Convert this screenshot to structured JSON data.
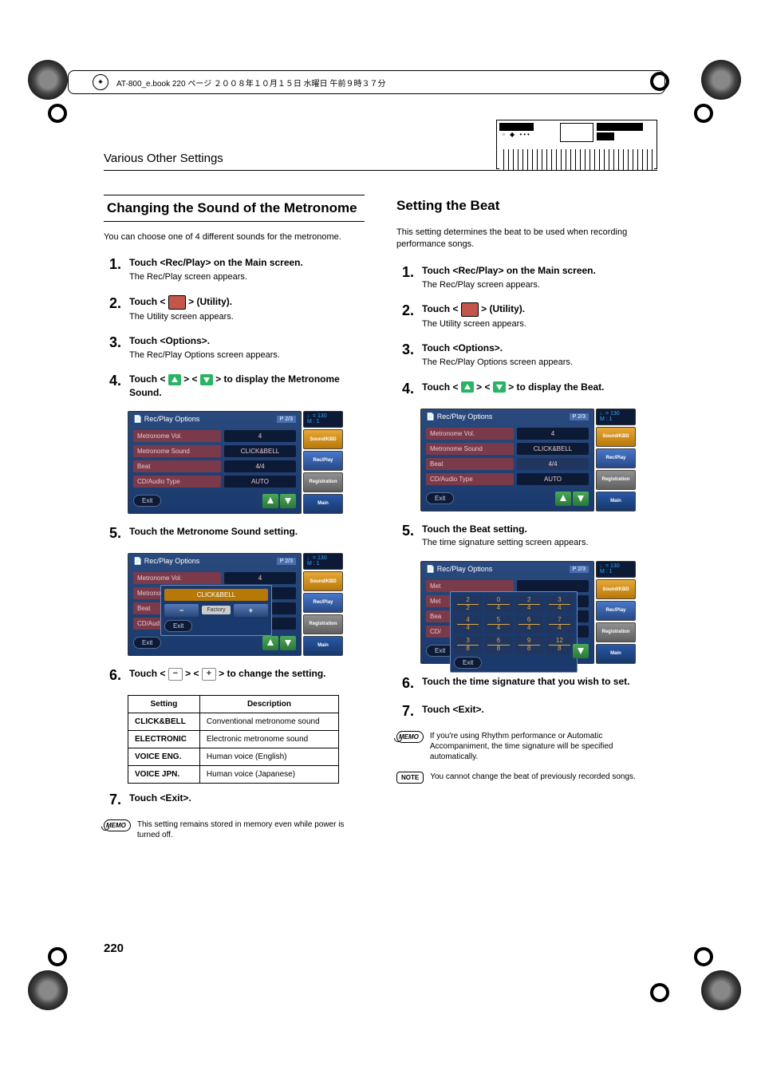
{
  "header_text": "AT-800_e.book  220 ページ  ２００８年１０月１５日  水曜日  午前９時３７分",
  "chapter": "Various Other Settings",
  "page_number": "220",
  "left": {
    "section_title": "Changing the Sound of the Metronome",
    "intro": "You can choose one of 4 different sounds for the metronome.",
    "steps": {
      "s1": {
        "title": "Touch <Rec/Play> on the Main screen.",
        "desc": "The Rec/Play screen appears."
      },
      "s2": {
        "pre": "Touch < ",
        "post": " > (Utility).",
        "desc": "The Utility screen appears."
      },
      "s3": {
        "title": "Touch <Options>.",
        "desc": "The Rec/Play Options screen appears."
      },
      "s4": {
        "pre": "Touch < ",
        "mid": " > < ",
        "post": " > to display the Metronome Sound."
      },
      "s5": {
        "title": "Touch the Metronome Sound setting."
      },
      "s6": {
        "pre": "Touch < ",
        "mid": " > < ",
        "post": " > to change the setting."
      },
      "s7": {
        "title": "Touch <Exit>."
      }
    },
    "memo": "This setting remains stored in memory even while power is turned off.",
    "table": {
      "headers": [
        "Setting",
        "Description"
      ],
      "rows": [
        [
          "CLICK&BELL",
          "Conventional metronome sound"
        ],
        [
          "ELECTRONIC",
          "Electronic metronome sound"
        ],
        [
          "VOICE ENG.",
          "Human voice (English)"
        ],
        [
          "VOICE JPN.",
          "Human voice (Japanese)"
        ]
      ]
    }
  },
  "right": {
    "section_title": "Setting the Beat",
    "intro": "This setting determines the beat to be used when recording performance songs.",
    "steps": {
      "s1": {
        "title": "Touch <Rec/Play> on the Main screen.",
        "desc": "The Rec/Play screen appears."
      },
      "s2": {
        "pre": "Touch < ",
        "post": " > (Utility).",
        "desc": "The Utility screen appears."
      },
      "s3": {
        "title": "Touch <Options>.",
        "desc": "The Rec/Play Options screen appears."
      },
      "s4": {
        "pre": "Touch < ",
        "mid": " > < ",
        "post": " > to display the Beat."
      },
      "s5": {
        "title": "Touch the Beat setting.",
        "desc": "The time signature setting screen appears."
      },
      "s6": {
        "title": "Touch the time signature that you wish to set."
      },
      "s7": {
        "title": "Touch <Exit>."
      }
    },
    "memo": "If you're using Rhythm performance or Automatic Accompaniment, the time signature will be specified automatically.",
    "note": "You cannot change the beat of previously recorded songs."
  },
  "screenshot_common": {
    "title": "Rec/Play Options",
    "page_indicator": "P 2/3",
    "tempo": "♩= 130",
    "measure": "M :    1",
    "rows": [
      {
        "label": "Metronome Vol.",
        "value": "4"
      },
      {
        "label": "Metronome Sound",
        "value": "CLICK&BELL"
      },
      {
        "label": "Beat",
        "value": "4/4"
      },
      {
        "label": "CD/Audio Type",
        "value": "AUTO"
      }
    ],
    "exit": "Exit",
    "side": {
      "sound_kbd": "Sound/KBD",
      "rec_play": "Rec/Play",
      "registration": "Registration",
      "main": "Main"
    }
  },
  "popup_sound": {
    "value": "CLICK&BELL",
    "factory": "Factory",
    "exit": "Exit"
  },
  "popup_timesig": {
    "rows": [
      [
        "2/2",
        "0/4",
        "2/4",
        "3/4"
      ],
      [
        "4/4",
        "5/4",
        "6/4",
        "7/4"
      ],
      [
        "3/8",
        "6/8",
        "9/8",
        "12/8"
      ]
    ],
    "exit": "Exit"
  },
  "badges": {
    "memo": "MEMO",
    "note": "NOTE"
  }
}
